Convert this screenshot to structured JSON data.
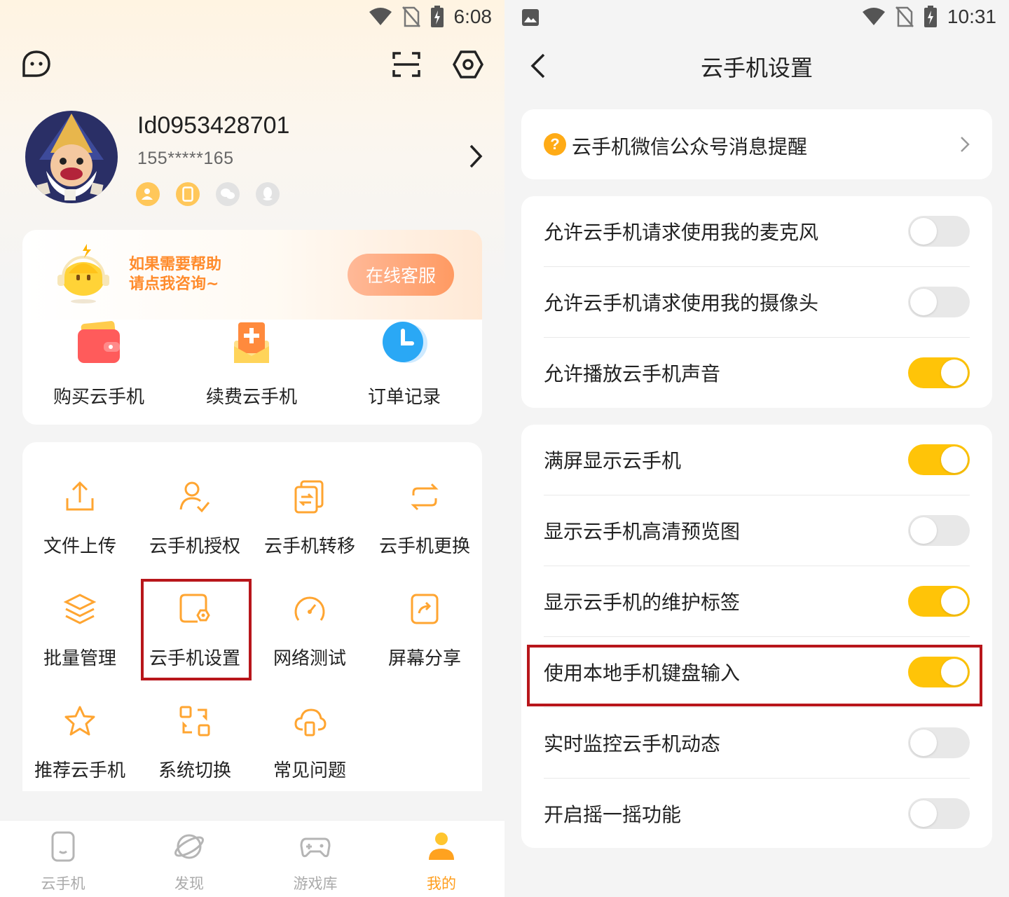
{
  "left": {
    "status": {
      "time": "6:08"
    },
    "profile": {
      "username": "Id0953428701",
      "phone": "155*****165"
    },
    "help": {
      "line1": "如果需要帮助",
      "line2": "请点我咨询~",
      "button": "在线客服"
    },
    "buy": [
      {
        "label": "购买云手机",
        "icon": "wallet-icon"
      },
      {
        "label": "续费云手机",
        "icon": "renew-icon"
      },
      {
        "label": "订单记录",
        "icon": "clock-icon"
      }
    ],
    "grid": [
      {
        "label": "文件上传",
        "icon": "upload-icon"
      },
      {
        "label": "云手机授权",
        "icon": "user-check-icon"
      },
      {
        "label": "云手机转移",
        "icon": "transfer-icon"
      },
      {
        "label": "云手机更换",
        "icon": "swap-icon"
      },
      {
        "label": "批量管理",
        "icon": "layers-icon"
      },
      {
        "label": "云手机设置",
        "icon": "settings-icon"
      },
      {
        "label": "网络测试",
        "icon": "speedometer-icon"
      },
      {
        "label": "屏幕分享",
        "icon": "share-icon"
      },
      {
        "label": "推荐云手机",
        "icon": "star-icon"
      },
      {
        "label": "系统切换",
        "icon": "switch-icon"
      },
      {
        "label": "常见问题",
        "icon": "cloud-question-icon"
      }
    ],
    "tabs": [
      {
        "label": "云手机",
        "icon": "phone-icon"
      },
      {
        "label": "发现",
        "icon": "planet-icon"
      },
      {
        "label": "游戏库",
        "icon": "gamepad-icon"
      },
      {
        "label": "我的",
        "icon": "user-icon"
      }
    ],
    "active_tab": "我的",
    "accent": "#ff9d1b"
  },
  "right": {
    "status": {
      "time": "10:31"
    },
    "title": "云手机设置",
    "wechat_reminder": "云手机微信公众号消息提醒",
    "group1": [
      {
        "label": "允许云手机请求使用我的麦克风",
        "on": false
      },
      {
        "label": "允许云手机请求使用我的摄像头",
        "on": false
      },
      {
        "label": "允许播放云手机声音",
        "on": true
      }
    ],
    "group2": [
      {
        "label": "满屏显示云手机",
        "on": true
      },
      {
        "label": "显示云手机高清预览图",
        "on": false
      },
      {
        "label": "显示云手机的维护标签",
        "on": true
      },
      {
        "label": "使用本地手机键盘输入",
        "on": true
      },
      {
        "label": "实时监控云手机动态",
        "on": false
      },
      {
        "label": "开启摇一摇功能",
        "on": false
      }
    ],
    "toggle_on_color": "#ffc408",
    "highlight_color": "#b8161b"
  }
}
